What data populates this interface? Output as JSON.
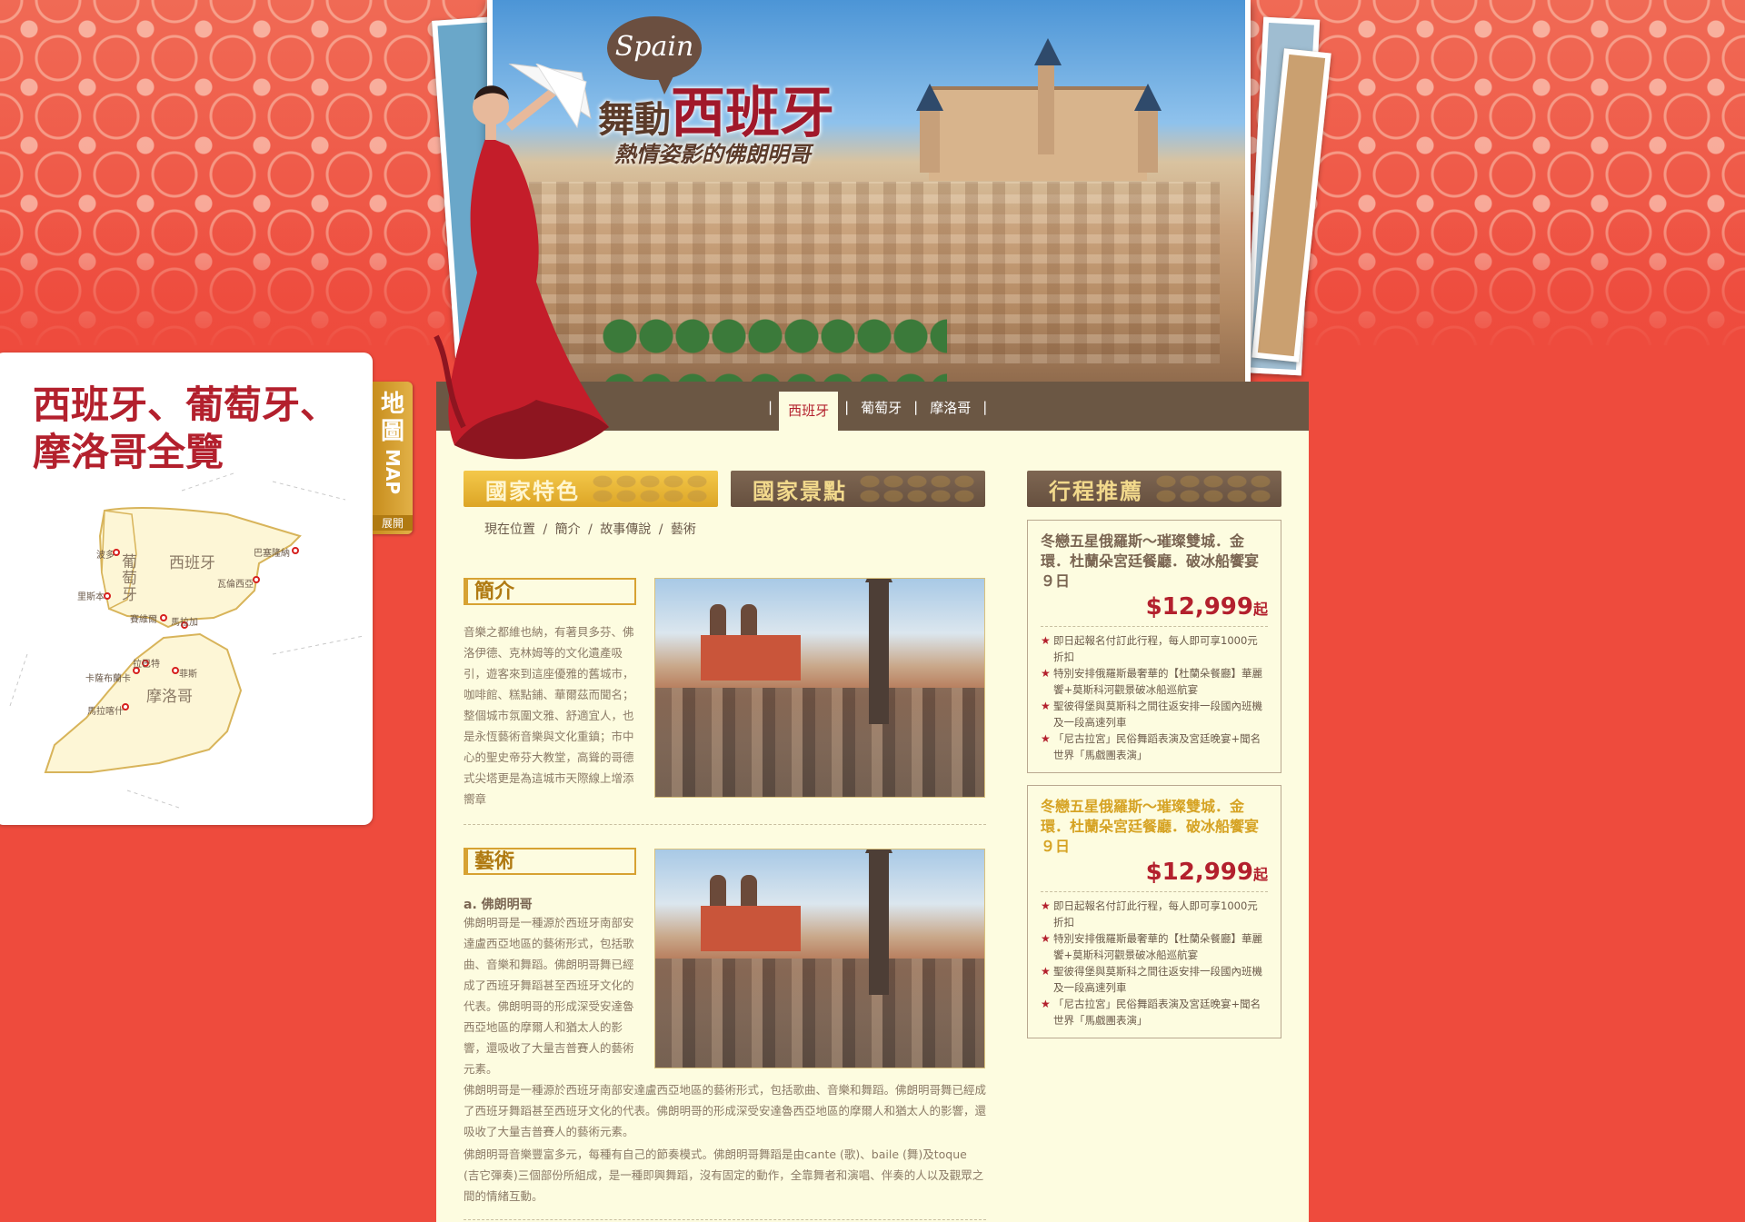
{
  "hero": {
    "badge": "Spain",
    "title_prefix": "舞動",
    "title_main": "西班牙",
    "subtitle": "熱情姿影的佛朗明哥"
  },
  "nav": {
    "items": [
      "西班牙",
      "葡萄牙",
      "摩洛哥"
    ],
    "active": "西班牙"
  },
  "tabs": {
    "features": "國家特色",
    "attractions": "國家景點",
    "itinerary": "行程推薦"
  },
  "breadcrumb": [
    "現在位置",
    "簡介",
    "故事傳說",
    "藝術"
  ],
  "sections": {
    "intro": {
      "heading": "簡介",
      "text": "音樂之都維也納，有著貝多芬、佛洛伊德、克林姆等的文化遺產吸引，遊客來到這座優雅的舊城市，咖啡館、糕點鋪、華爾茲而聞名；整個城市氛圍文雅、舒適宜人，也是永恆藝術音樂與文化重鎮；市中心的聖史帝芬大教堂，高聳的哥德式尖塔更是為這城市天際線上增添嚮章"
    },
    "art": {
      "heading": "藝術",
      "sub_title": "a. 佛朗明哥",
      "text_narrow": "佛朗明哥是一種源於西班牙南部安達盧西亞地區的藝術形式，包括歌曲、音樂和舞蹈。佛朗明哥舞已經成了西班牙舞蹈甚至西班牙文化的代表。佛朗明哥的形成深受安達魯西亞地區的摩爾人和猶太人的影響，還吸收了大量吉普賽人的藝術元素。",
      "text_wide_1": "佛朗明哥是一種源於西班牙南部安達盧西亞地區的藝術形式，包括歌曲、音樂和舞蹈。佛朗明哥舞已經成了西班牙舞蹈甚至西班牙文化的代表。佛朗明哥的形成深受安達魯西亞地區的摩爾人和猶太人的影響，還吸收了大量吉普賽人的藝術元素。",
      "text_wide_2": "佛朗明哥音樂豐富多元，每種有自己的節奏模式。佛朗明哥舞蹈是由cante (歌)、baile (舞)及toque (吉它彈奏)三個部份所組成，是一種即興舞蹈，沒有固定的動作，全靠舞者和演唱、伴奏的人以及觀眾之間的情緒互動。"
    }
  },
  "trips": [
    {
      "title": "冬戀五星俄羅斯～璀璨雙城．金環．杜蘭朵宮廷餐廳．破冰船饗宴９日",
      "price": "$12,999",
      "price_suffix": "起",
      "bullets": [
        "即日起報名付訂此行程，每人即可享1000元折扣",
        "特別安排俄羅斯最奢華的【杜蘭朵餐廳】華麗饗+莫斯科河觀景破冰船巡航宴",
        "聖彼得堡與莫斯科之間往返安排一段國內班機及一段高速列車",
        "「尼古拉宮」民俗舞蹈表演及宮廷晚宴+聞名世界「馬戲團表演」"
      ]
    },
    {
      "title": "冬戀五星俄羅斯～璀璨雙城．金環．杜蘭朵宮廷餐廳．破冰船饗宴９日",
      "price": "$12,999",
      "price_suffix": "起",
      "bullets": [
        "即日起報名付訂此行程，每人即可享1000元折扣",
        "特別安排俄羅斯最奢華的【杜蘭朵餐廳】華麗饗+莫斯科河觀景破冰船巡航宴",
        "聖彼得堡與莫斯科之間往返安排一段國內班機及一段高速列車",
        "「尼古拉宮」民俗舞蹈表演及宮廷晚宴+聞名世界「馬戲團表演」"
      ]
    }
  ],
  "map_panel": {
    "title_line1": "西班牙、葡萄牙、",
    "title_line2": "摩洛哥全覽",
    "tab_cjk": "地圖",
    "tab_en": "MAP",
    "tab_expand": "展開",
    "countries": {
      "spain": "西班牙",
      "portugal": "葡萄牙",
      "morocco": "摩洛哥"
    },
    "cities": {
      "porto": "波多",
      "barcelona": "巴塞隆納",
      "valencia": "瓦倫西亞",
      "lisbon": "里斯本",
      "seville": "賽維爾",
      "malaga": "馬拉加",
      "rabat": "拉巴特",
      "casablanca": "卡薩布蘭卡",
      "fes": "菲斯",
      "marrakech": "馬拉喀什"
    }
  },
  "colors": {
    "background_red": "#ee4b3d",
    "content_cream": "#fdfce0",
    "nav_brown": "#6b5744",
    "accent_red": "#b3202d",
    "gold": "#dca526"
  }
}
